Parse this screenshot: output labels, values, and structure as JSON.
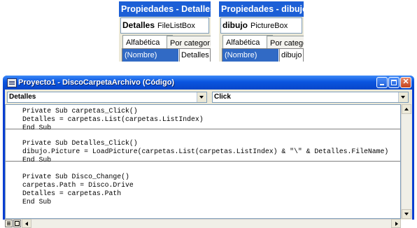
{
  "properties_windows": [
    {
      "title": "Propiedades - Detalles",
      "object_name": "Detalles",
      "object_type": "FileListBox",
      "tabs": [
        "Alfabética",
        "Por categoría"
      ],
      "selected_property": "(Nombre)",
      "selected_value": "Detalles"
    },
    {
      "title": "Propiedades - dibujo",
      "object_name": "dibujo",
      "object_type": "PictureBox",
      "tabs": [
        "Alfabética",
        "Por categoría"
      ],
      "selected_property": "(Nombre)",
      "selected_value": "dibujo"
    }
  ],
  "code_window": {
    "title": "Proyecto1 - DiscoCarpetaArchivo (Código)",
    "object_combo": "Detalles",
    "procedure_combo": "Click",
    "procedures": [
      [
        "Private Sub carpetas_Click()",
        "Detalles = carpetas.List(carpetas.ListIndex)",
        "End Sub"
      ],
      [
        "Private Sub Detalles_Click()",
        "dibujo.Picture = LoadPicture(carpetas.List(carpetas.ListIndex) & \"\\\" & Detalles.FileName)",
        "End Sub"
      ],
      [
        "Private Sub Disco_Change()",
        "carpetas.Path = Disco.Drive",
        "Detalles = carpetas.Path",
        "End Sub"
      ]
    ]
  },
  "colors": {
    "title_active": "#0a55e0",
    "properties_title": "#1c5fd6",
    "selection": "#316ac5"
  }
}
